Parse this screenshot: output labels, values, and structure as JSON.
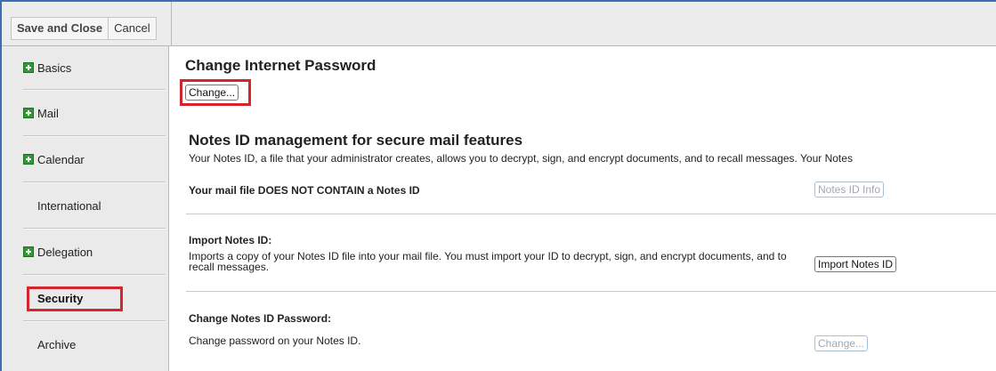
{
  "toolbar": {
    "save_close_label": "Save and Close",
    "cancel_label": "Cancel"
  },
  "sidebar": {
    "items": [
      {
        "label": "Basics",
        "expandable": true
      },
      {
        "label": "Mail",
        "expandable": true
      },
      {
        "label": "Calendar",
        "expandable": true
      },
      {
        "label": "International",
        "expandable": false
      },
      {
        "label": "Delegation",
        "expandable": true
      },
      {
        "label": "Security",
        "expandable": false,
        "selected": true
      },
      {
        "label": "Archive",
        "expandable": false
      }
    ]
  },
  "internet_password": {
    "title": "Change Internet Password",
    "change_button": "Change..."
  },
  "notes_id": {
    "title": "Notes ID management for secure mail features",
    "description": "Your Notes ID, a file that your administrator creates, allows you to decrypt, sign, and encrypt documents, and to recall messages. Your Notes",
    "status": "Your mail file DOES NOT CONTAIN a Notes ID",
    "info_button": "Notes ID Info",
    "import_title": "Import Notes ID:",
    "import_description": "Imports a copy of your Notes ID file into your mail file. You must import your ID to decrypt, sign, and encrypt documents, and to recall messages.",
    "import_button": "Import Notes ID",
    "change_pw_title": "Change Notes ID Password:",
    "change_pw_description": "Change password on your Notes ID.",
    "change_pw_button": "Change..."
  },
  "colors": {
    "highlight": "#d6242c",
    "expand_icon": "#2f9a33",
    "frame": "#3a6fb5"
  }
}
